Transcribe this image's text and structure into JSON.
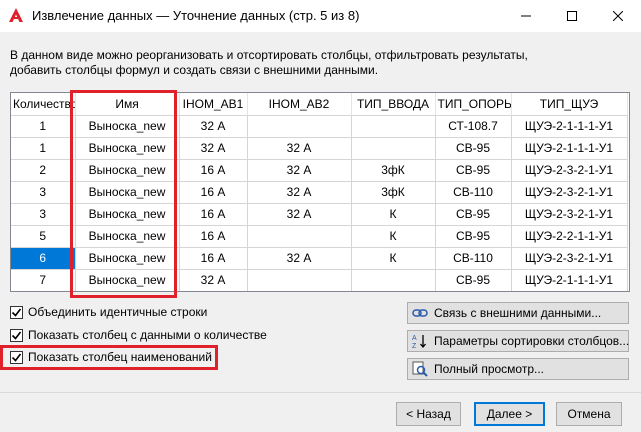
{
  "window": {
    "title": "Извлечение данных — Уточнение данных (стр. 5 из 8)",
    "app_icon": "autocad-a-icon",
    "brand_color": "#e0202a"
  },
  "description": {
    "line1": "В данном виде можно реорганизовать и отсортировать столбцы, отфильтровать результаты,",
    "line2": "добавить столбцы формул и создать связи с внешними данными."
  },
  "grid": {
    "columns": [
      "Количество",
      "Имя",
      "IНОМ_АВ1",
      "IНОМ_АВ2",
      "ТИП_ВВОДА",
      "ТИП_ОПОРЫ",
      "ТИП_ЩУЭ"
    ],
    "rows": [
      [
        "1",
        "Выноска_new",
        "32 А",
        "",
        "",
        "СТ-108.7",
        "ЩУЭ-2-1-1-1-У1"
      ],
      [
        "1",
        "Выноска_new",
        "32 А",
        "32 А",
        "",
        "СВ-95",
        "ЩУЭ-2-1-1-1-У1"
      ],
      [
        "2",
        "Выноска_new",
        "16 А",
        "32 А",
        "3фК",
        "СВ-95",
        "ЩУЭ-2-3-2-1-У1"
      ],
      [
        "3",
        "Выноска_new",
        "16 А",
        "32 А",
        "3фК",
        "СВ-110",
        "ЩУЭ-2-3-2-1-У1"
      ],
      [
        "3",
        "Выноска_new",
        "16 А",
        "32 А",
        "К",
        "СВ-95",
        "ЩУЭ-2-3-2-1-У1"
      ],
      [
        "5",
        "Выноска_new",
        "16 А",
        "",
        "К",
        "СВ-95",
        "ЩУЭ-2-2-1-1-У1"
      ],
      [
        "6",
        "Выноска_new",
        "16 А",
        "32 А",
        "К",
        "СВ-110",
        "ЩУЭ-2-3-2-1-У1"
      ],
      [
        "7",
        "Выноска_new",
        "32 А",
        "",
        "",
        "СВ-95",
        "ЩУЭ-2-1-1-1-У1"
      ]
    ],
    "selected_row_index": 6,
    "highlight_color": "#e0202a",
    "selection_color": "#0078d7"
  },
  "options": {
    "combine_identical": {
      "label": "Объединить идентичные строки",
      "checked": true
    },
    "show_count_column": {
      "label": "Показать столбец с данными о количестве",
      "checked": true
    },
    "show_name_column": {
      "label": "Показать столбец наименований",
      "checked": true
    }
  },
  "side_buttons": {
    "link_external": "Связь с внешними данными...",
    "sort_params": "Параметры сортировки столбцов...",
    "full_preview": "Полный просмотр..."
  },
  "footer": {
    "back": "< Назад",
    "next": "Далее >",
    "cancel": "Отмена"
  }
}
